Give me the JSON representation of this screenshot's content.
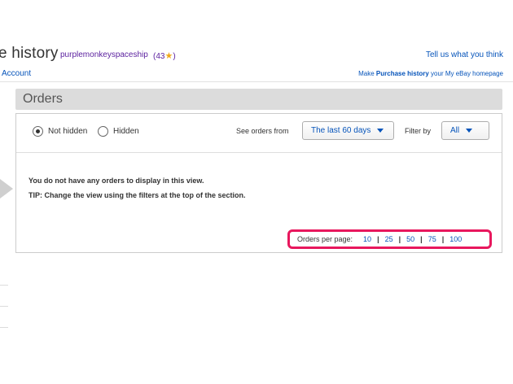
{
  "header": {
    "title": "e history",
    "username": "purplemonkeyspaceship",
    "feedback_open": "(43",
    "feedback_star": "★",
    "feedback_close": ")",
    "tell_us": "Tell us what you think",
    "account_link": "Account",
    "make_prefix": "Make ",
    "make_bold": "Purchase history",
    "make_suffix": " your My eBay homepage"
  },
  "section": {
    "title": "Orders"
  },
  "filters": {
    "radio_not_hidden": "Not hidden",
    "radio_hidden": "Hidden",
    "selected_radio": "Not hidden",
    "see_orders_label": "See orders from",
    "period_value": "The last 60 days",
    "filter_by_label": "Filter by",
    "filter_value": "All"
  },
  "messages": {
    "empty": "You do not have any orders to display in this view.",
    "tip": "TIP: Change the view using the filters at the top of the section."
  },
  "per_page": {
    "label": "Orders per page:",
    "options": [
      "10",
      "25",
      "50",
      "75",
      "100"
    ],
    "separator": "|"
  },
  "colors": {
    "link": "#0654ba",
    "username": "#5a1f9e",
    "highlight": "#e8175d",
    "star": "#f0a81a"
  }
}
